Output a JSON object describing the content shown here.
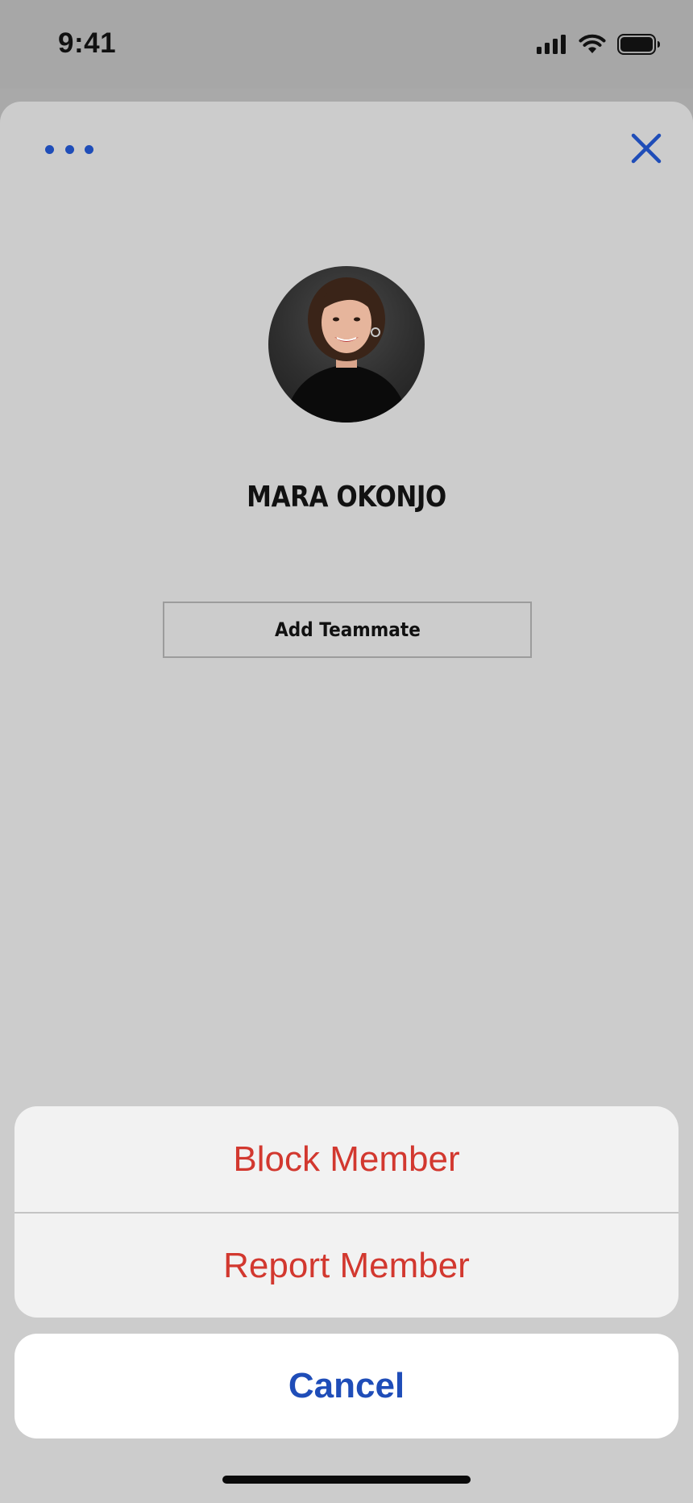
{
  "status_bar": {
    "time": "9:41",
    "icons": [
      "signal-icon",
      "wifi-icon",
      "battery-icon"
    ]
  },
  "header": {
    "more_icon": "ellipsis-icon",
    "close_icon": "close-icon"
  },
  "profile": {
    "name": "MARA OKONJO",
    "add_button_label": "Add Teammate"
  },
  "action_sheet": {
    "items": [
      {
        "label": "Block Member"
      },
      {
        "label": "Report Member"
      }
    ],
    "cancel_label": "Cancel"
  },
  "colors": {
    "accent": "#1f4db8",
    "destructive": "#d2382f",
    "sheet_background": "#cccccc"
  }
}
